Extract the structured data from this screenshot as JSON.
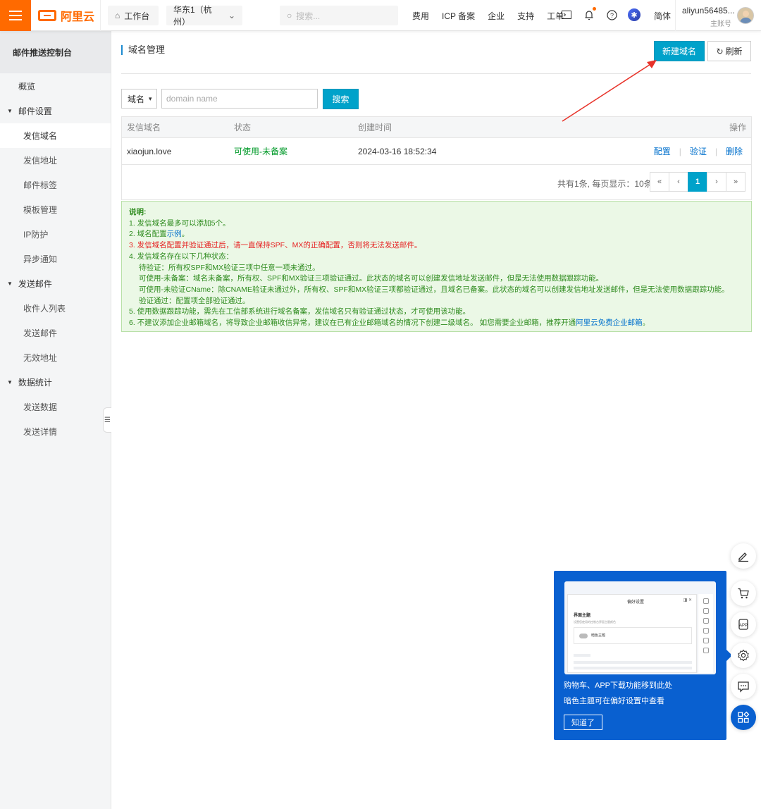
{
  "topbar": {
    "logo_text": "阿里云",
    "workbench": "工作台",
    "region": "华东1（杭州）",
    "search_placeholder": "搜索...",
    "nav": [
      "费用",
      "ICP 备案",
      "企业",
      "支持",
      "工单"
    ],
    "lang": "简体",
    "user_name": "aliyun56485...",
    "user_role": "主账号",
    "accent": "#ff6a00"
  },
  "sidebar": {
    "title": "邮件推送控制台",
    "overview": "概览",
    "groups": [
      {
        "label": "邮件设置",
        "items": [
          "发信域名",
          "发信地址",
          "邮件标签",
          "模板管理",
          "IP防护",
          "异步通知"
        ]
      },
      {
        "label": "发送邮件",
        "items": [
          "收件人列表",
          "发送邮件",
          "无效地址"
        ]
      },
      {
        "label": "数据统计",
        "items": [
          "发送数据",
          "发送详情"
        ]
      }
    ]
  },
  "main": {
    "title": "域名管理",
    "new_button": "新建域名",
    "refresh_button": "刷新",
    "filter_select": "域名",
    "filter_placeholder": "domain name",
    "search_button": "搜索",
    "columns": [
      "发信域名",
      "状态",
      "创建时间",
      "操作"
    ],
    "rows": [
      {
        "domain": "xiaojun.love",
        "status": "可使用-未备案",
        "created": "2024-03-16 18:52:34",
        "ops": [
          "配置",
          "验证",
          "删除"
        ]
      }
    ],
    "pager_text": "共有1条, 每页显示：10条",
    "pager": [
      "«",
      "‹",
      "1",
      "›",
      "»"
    ],
    "primary_color": "#00a2ca"
  },
  "notice": {
    "title": "说明:",
    "line1": "1. 发信域名最多可以添加5个。",
    "line2_prefix": "2. 域名配置",
    "line2_link": "示例",
    "line2_suffix": "。",
    "line3": "3. 发信域名配置并验证通过后，请一直保持SPF、MX的正确配置，否则将无法发送邮件。",
    "line4": "4. 发信域名存在以下几种状态：",
    "line4a": "待验证：所有权SPF和MX验证三项中任意一项未通过。",
    "line4b": "可使用-未备案：域名未备案，所有权、SPF和MX验证三项验证通过。此状态的域名可以创建发信地址发送邮件，但是无法使用数据跟踪功能。",
    "line4c": "可使用-未验证CName：除CNAME验证未通过外，所有权、SPF和MX验证三项都验证通过，且域名已备案。此状态的域名可以创建发信地址发送邮件，但是无法使用数据跟踪功能。",
    "line4d": "验证通过：配置项全部验证通过。",
    "line5": "5. 使用数据跟踪功能，需先在工信部系统进行域名备案，发信域名只有验证通过状态，才可使用该功能。",
    "line6_prefix": "6. 不建议添加企业邮箱域名，将导致企业邮箱收信异常，建议在已有企业邮箱域名的情况下创建二级域名。 如您需要企业邮箱，推荐开通",
    "line6_link": "阿里云免费企业邮箱",
    "line6_suffix": "。"
  },
  "tip": {
    "panel_title": "偏好设置",
    "panel_head": "界面主题",
    "panel_sub": "设置您使用的控制台界面主题颜色",
    "panel_toggle": "暗色主题",
    "line1": "购物车、APP下载功能移到此处",
    "line2": "暗色主题可在偏好设置中查看",
    "button": "知道了"
  }
}
